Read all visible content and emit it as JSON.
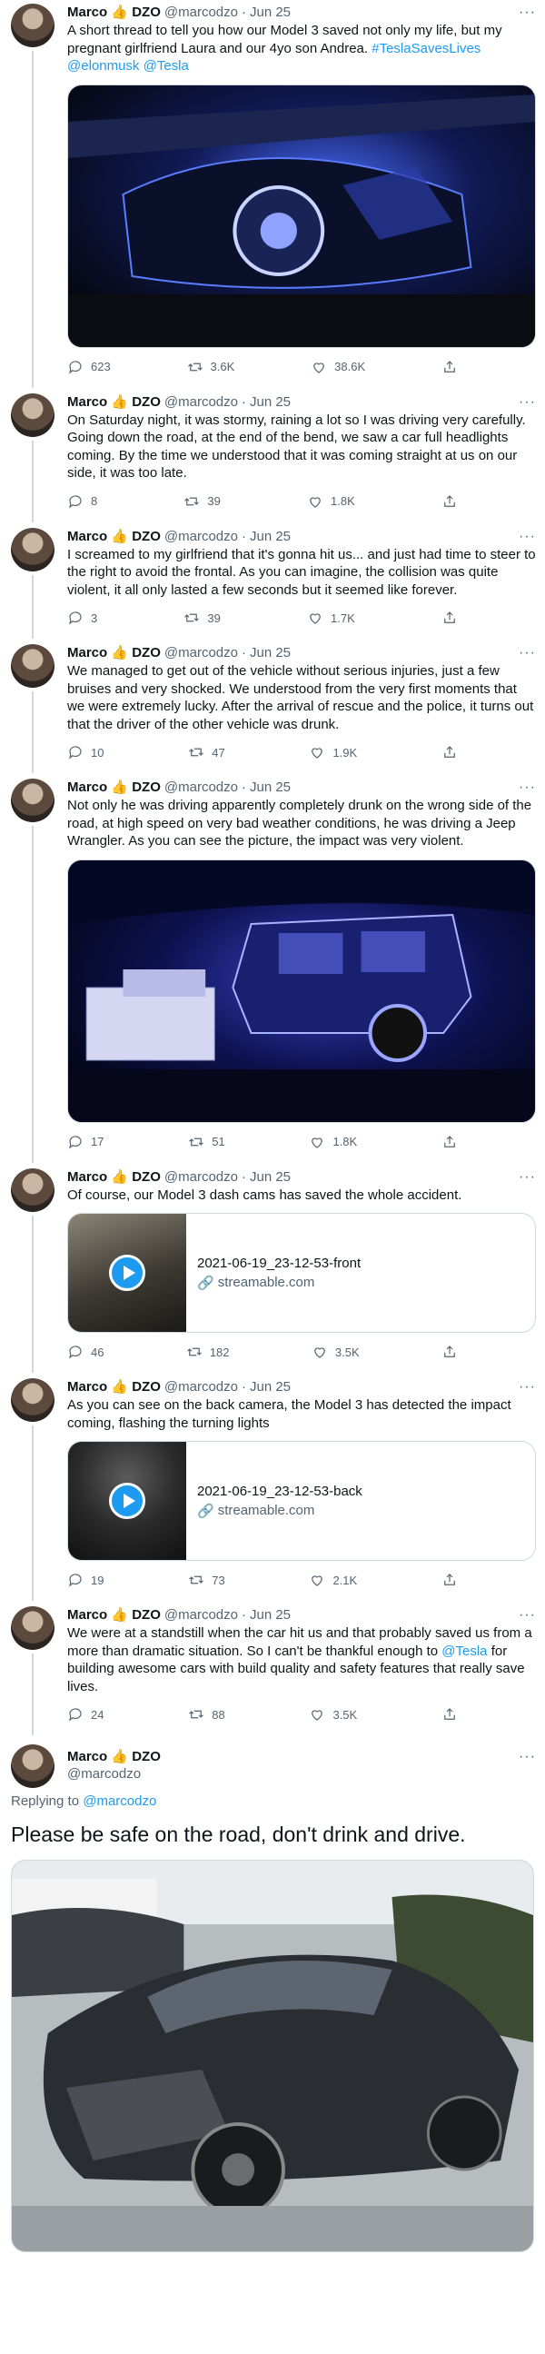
{
  "author": {
    "name": "Marco",
    "emoji": "👍",
    "suffix": "DZO",
    "handle": "@marcodzo",
    "date": "Jun 25"
  },
  "tweets": [
    {
      "text_parts": [
        "A short thread to tell you how our Model 3 saved not only my life, but my pregnant girlfriend Laura and our 4yo son Andrea. "
      ],
      "hashtag": "#TeslaSavesLives",
      "mentions": "@elonmusk @Tesla",
      "stats": {
        "replies": "623",
        "retweets": "3.6K",
        "likes": "38.6K"
      }
    },
    {
      "text": "On Saturday night, it was stormy, raining a lot so I was driving very carefully. Going down the road, at the end of the bend, we saw a car full headlights coming. By the time we understood that it was coming straight at us on our side, it was too late.",
      "stats": {
        "replies": "8",
        "retweets": "39",
        "likes": "1.8K"
      }
    },
    {
      "text": "I screamed to my girlfriend that it's gonna hit us... and just had time to steer to the right to avoid the frontal. As you can imagine, the collision was quite violent, it all only lasted a few seconds but it seemed like forever.",
      "stats": {
        "replies": "3",
        "retweets": "39",
        "likes": "1.7K"
      }
    },
    {
      "text": "We managed to get out of the vehicle without serious injuries, just a few bruises and very shocked. We understood from the very first moments that we were extremely lucky. After the arrival of rescue and the police, it turns out that the driver of the other vehicle was drunk.",
      "stats": {
        "replies": "10",
        "retweets": "47",
        "likes": "1.9K"
      }
    },
    {
      "text": "Not only he was driving apparently completely drunk on the wrong side of the road, at high speed on very bad weather conditions, he was driving a Jeep Wrangler. As you can see the picture, the impact was very violent.",
      "stats": {
        "replies": "17",
        "retweets": "51",
        "likes": "1.8K"
      }
    },
    {
      "text": "Of course, our Model 3 dash cams has saved the whole accident.",
      "card": {
        "title": "2021-06-19_23-12-53-front",
        "domain": "streamable.com"
      },
      "stats": {
        "replies": "46",
        "retweets": "182",
        "likes": "3.5K"
      }
    },
    {
      "text": "As you can see on the back camera, the Model 3 has detected the impact coming, flashing the turning lights",
      "card": {
        "title": "2021-06-19_23-12-53-back",
        "domain": "streamable.com"
      },
      "stats": {
        "replies": "19",
        "retweets": "73",
        "likes": "2.1K"
      }
    },
    {
      "text_before": "We were at a standstill when the car hit us and that probably saved us from a more than dramatic situation. So I can't be thankful enough to ",
      "mention": "@Tesla",
      "text_after": " for building awesome cars with build quality and safety features that really save lives.",
      "stats": {
        "replies": "24",
        "retweets": "88",
        "likes": "3.5K"
      }
    }
  ],
  "final": {
    "replying_label": "Replying to",
    "replying_to": "@marcodzo",
    "text": "Please be safe on the road, don't drink and drive."
  }
}
